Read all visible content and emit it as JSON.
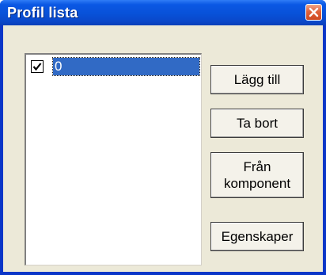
{
  "window": {
    "title": "Profil lista"
  },
  "profile_list": {
    "items": [
      {
        "label": "0",
        "checked": true,
        "selected": true
      }
    ]
  },
  "buttons": {
    "add": "Lägg till",
    "remove": "Ta bort",
    "from_component_line1": "Från",
    "from_component_line2": "komponent",
    "properties": "Egenskaper"
  },
  "icons": {
    "close": "close-icon",
    "checkmark": "checkmark-icon"
  },
  "colors": {
    "titlebar": "#0b58e4",
    "selection": "#316ac5",
    "dialog_background": "#ece9d8",
    "close_button": "#e0623b"
  }
}
